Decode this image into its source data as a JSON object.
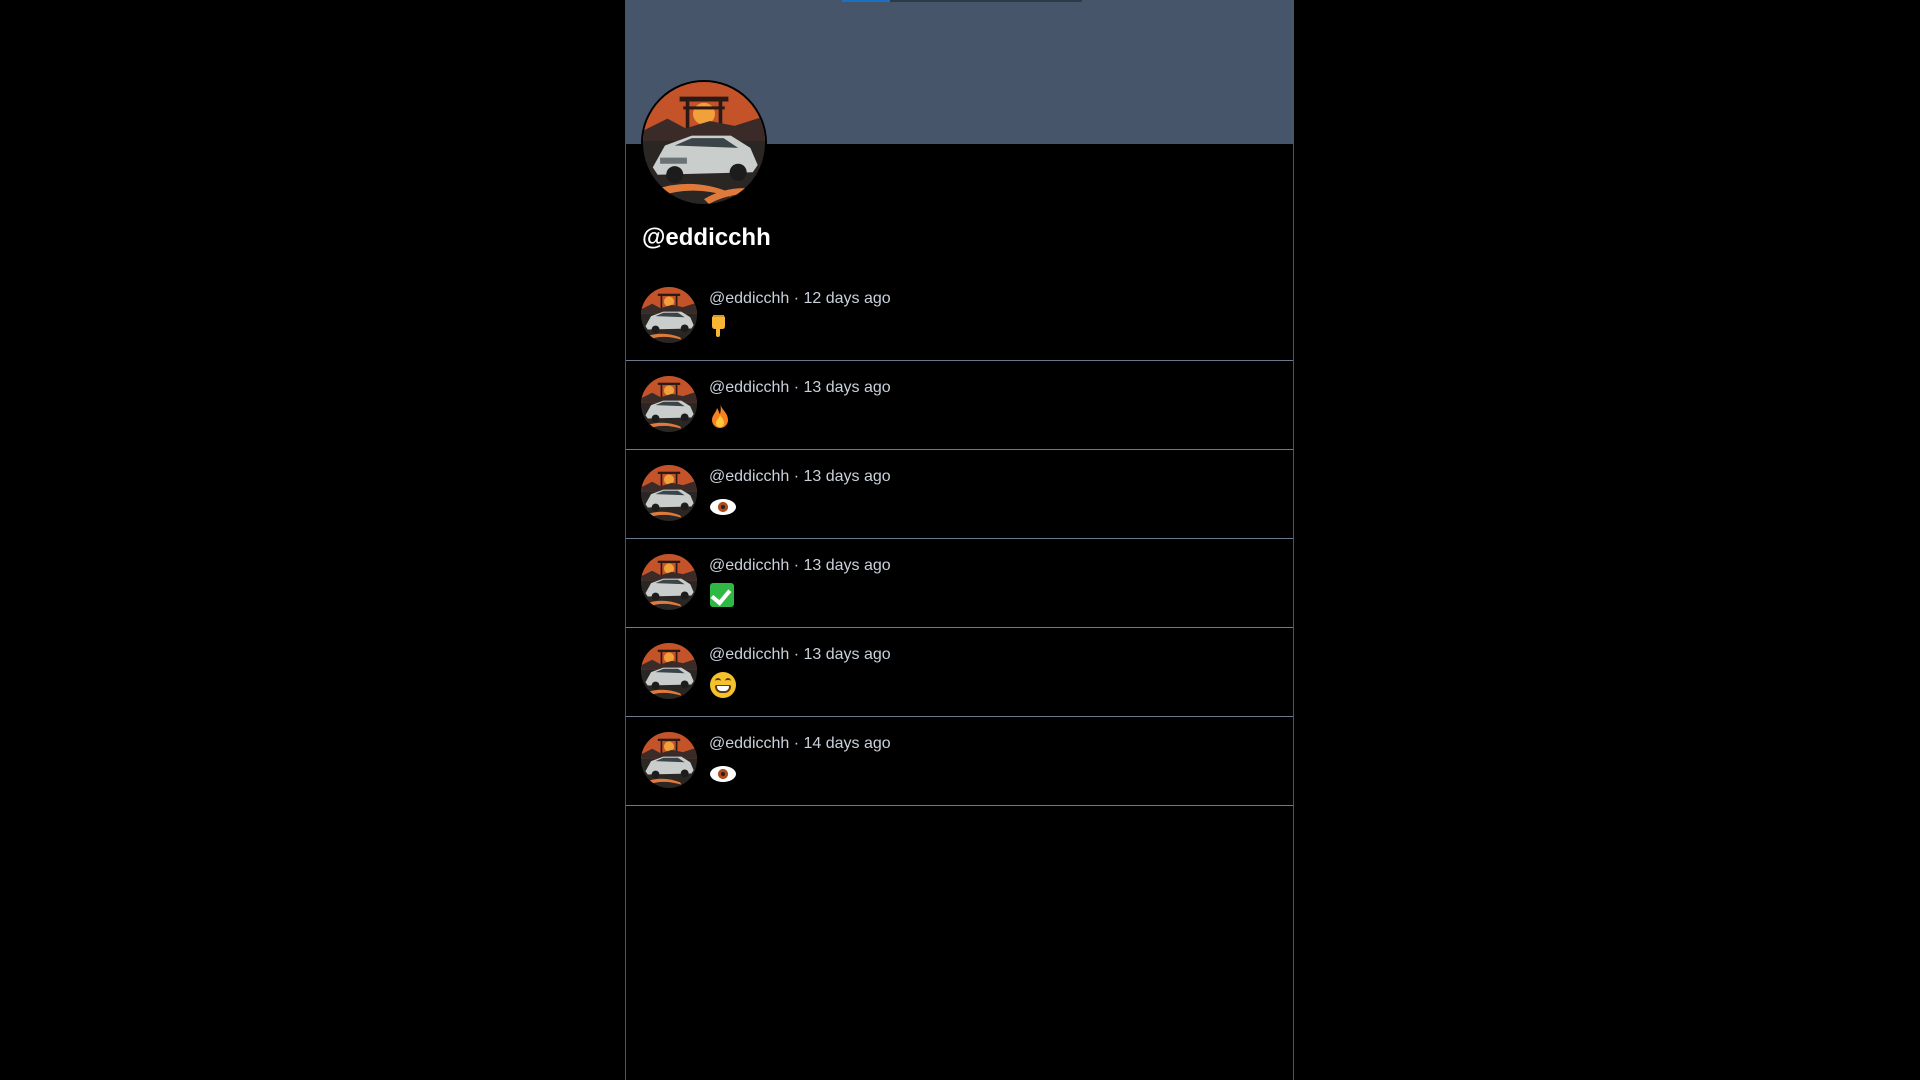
{
  "profile": {
    "handle": "@eddicchh"
  },
  "banner": {
    "color": "#465569",
    "progress_accent": "#1d6fc2",
    "progress_fraction": 0.2
  },
  "posts": [
    {
      "author": "@eddicchh",
      "separator": " · ",
      "time": "12 days ago",
      "emoji": "backhand-index-pointing-down",
      "text": "👇"
    },
    {
      "author": "@eddicchh",
      "separator": " · ",
      "time": "13 days ago",
      "emoji": "fire",
      "text": "🔥"
    },
    {
      "author": "@eddicchh",
      "separator": " · ",
      "time": "13 days ago",
      "emoji": "eye",
      "text": "👁"
    },
    {
      "author": "@eddicchh",
      "separator": " · ",
      "time": "13 days ago",
      "emoji": "check-mark-button",
      "text": "✅"
    },
    {
      "author": "@eddicchh",
      "separator": " · ",
      "time": "13 days ago",
      "emoji": "grinning-face",
      "text": "😁"
    },
    {
      "author": "@eddicchh",
      "separator": " · ",
      "time": "14 days ago",
      "emoji": "eye",
      "text": "👁"
    }
  ]
}
